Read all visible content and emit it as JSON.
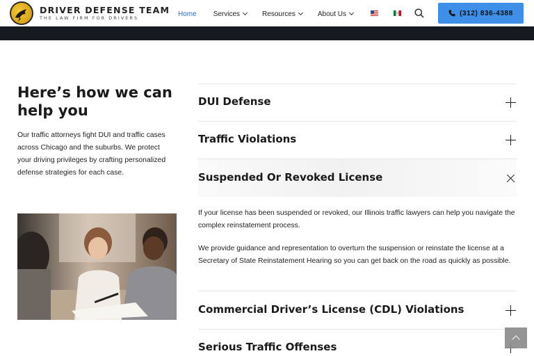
{
  "brand": {
    "name": "DRIVER DEFENSE TEAM",
    "tagline": "THE LAW FIRM FOR DRIVERS",
    "logo_icon": "bird-logo-icon",
    "accent_color": "#f3c83a"
  },
  "nav": {
    "items": [
      {
        "label": "Home",
        "active": true,
        "dropdown": false
      },
      {
        "label": "Services",
        "active": false,
        "dropdown": true
      },
      {
        "label": "Resources",
        "active": false,
        "dropdown": true
      },
      {
        "label": "About Us",
        "active": false,
        "dropdown": true
      }
    ],
    "active_color": "#1e6fd9",
    "flags": [
      "us-flag-icon",
      "mexico-flag-icon"
    ],
    "search_icon": "search-icon"
  },
  "call_button": {
    "label": "(312) 836-4388",
    "icon": "phone-icon",
    "color": "#3d8fe8"
  },
  "intro": {
    "title": "Here’s how we can help you",
    "text": "Our traffic attorneys fight DUI and traffic cases across Chicago and the suburbs. We protect your driving privileges by crafting personalized defense strategies for each case."
  },
  "accordion": {
    "items": [
      {
        "title": "DUI Defense",
        "expanded": false
      },
      {
        "title": "Traffic Violations",
        "expanded": false
      },
      {
        "title": "Suspended Or Revoked License",
        "expanded": true,
        "paragraphs": [
          "If your license has been suspended or revoked, our Illinois traffic lawyers can help you navigate the complex reinstatement process.",
          "We provide guidance and representation to overturn the suspension or reinstate the license at a Secretary of State Reinstatement Hearing so you can get back on the road as quickly as possible."
        ]
      },
      {
        "title": "Commercial Driver’s License (CDL) Violations",
        "expanded": false
      },
      {
        "title": "Serious Traffic Offenses",
        "expanded": false
      }
    ]
  },
  "scroll_top_icon": "chevron-up-icon"
}
